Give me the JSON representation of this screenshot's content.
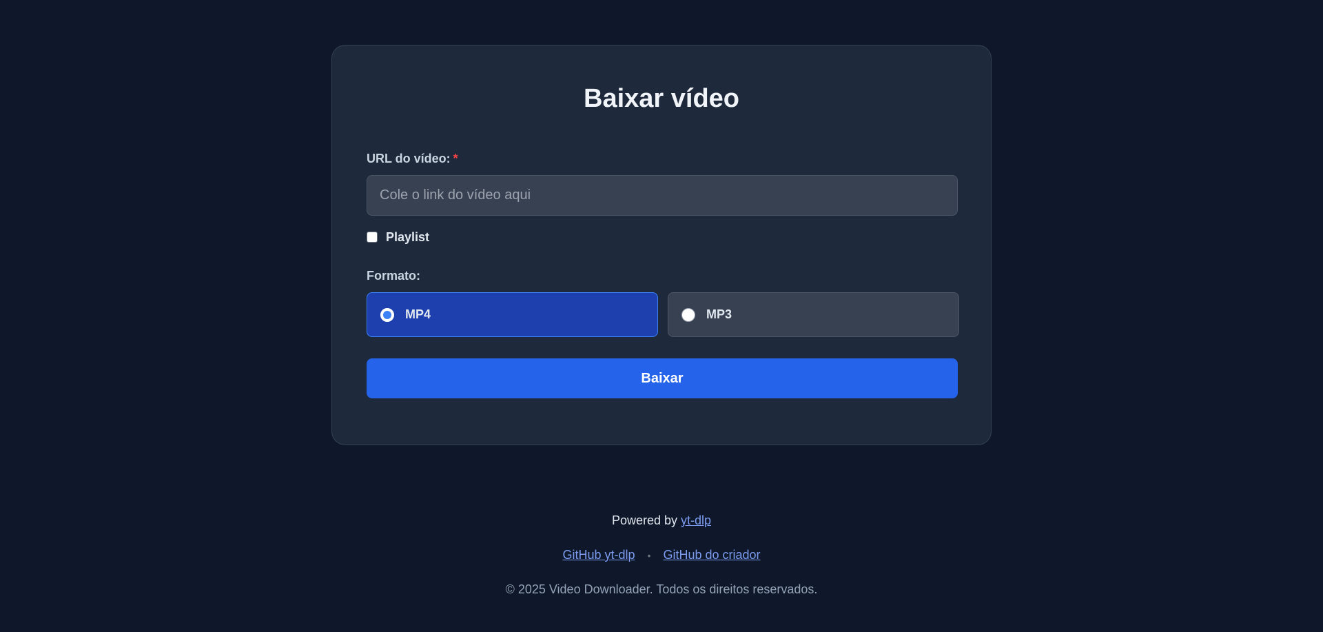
{
  "form": {
    "title": "Baixar vídeo",
    "url_label": "URL do vídeo:",
    "required_marker": "*",
    "url_placeholder": "Cole o link do vídeo aqui",
    "url_value": "",
    "playlist_label": "Playlist",
    "playlist_checked": false,
    "format_label": "Formato:",
    "format_options": [
      {
        "label": "MP4",
        "selected": true
      },
      {
        "label": "MP3",
        "selected": false
      }
    ],
    "submit_label": "Baixar"
  },
  "footer": {
    "powered_prefix": "Powered by",
    "powered_link": "yt-dlp",
    "links": [
      "GitHub yt-dlp",
      "GitHub do criador"
    ],
    "separator": "•",
    "copyright": "© 2025 Video Downloader. Todos os direitos reservados."
  },
  "colors": {
    "background": "#0f172a",
    "card": "#1e293b",
    "accent": "#2563eb",
    "selected_option": "#1e40af",
    "link": "#7c9cf0",
    "required": "#ef4444"
  }
}
